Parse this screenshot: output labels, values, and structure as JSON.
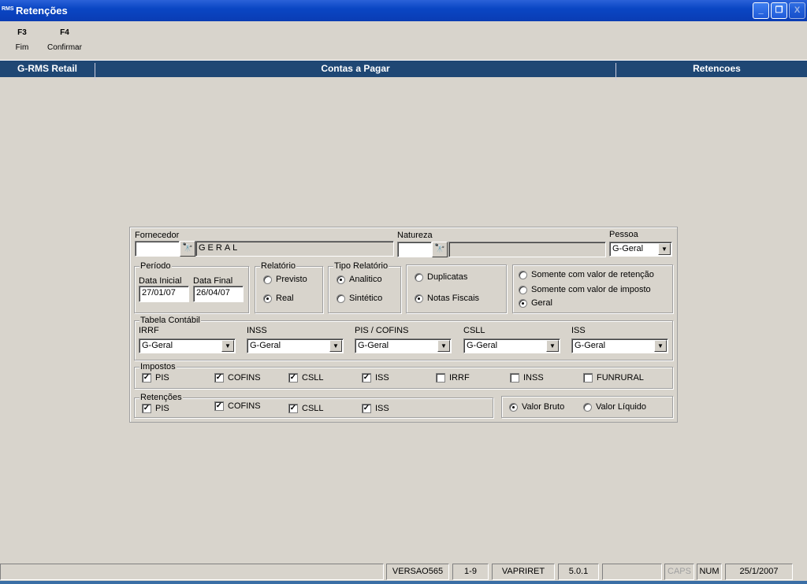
{
  "window": {
    "title": "Retenções",
    "logo": "RMS"
  },
  "toolbar": [
    {
      "key": "F3",
      "label": "Fim"
    },
    {
      "key": "F4",
      "label": "Confirmar"
    }
  ],
  "band": {
    "left": "G-RMS Retail",
    "center": "Contas a Pagar",
    "right": "Retencoes"
  },
  "form": {
    "fornecedor": {
      "label": "Fornecedor",
      "code": "",
      "desc": "GERAL"
    },
    "natureza": {
      "label": "Natureza",
      "code": "",
      "desc": ""
    },
    "pessoa": {
      "label": "Pessoa",
      "value": "G-Geral"
    },
    "periodo": {
      "label": "Período",
      "inicial_label": "Data Inicial",
      "inicial": "27/01/07",
      "final_label": "Data Final",
      "final": "26/04/07"
    },
    "relatorio": {
      "label": "Relatório",
      "options": [
        "Previsto",
        "Real"
      ],
      "selected": "Real"
    },
    "tipo": {
      "label": "Tipo Relatório",
      "options": [
        "Analitico",
        "Sintético"
      ],
      "selected": "Analitico"
    },
    "doc": {
      "options": [
        "Duplicatas",
        "Notas Fiscais"
      ],
      "selected": "Notas Fiscais"
    },
    "filtro": {
      "options": [
        "Somente com valor de retenção",
        "Somente com valor de imposto",
        "Geral"
      ],
      "selected": "Geral"
    },
    "tabela": {
      "label": "Tabela Contábil",
      "fields": [
        {
          "label": "IRRF",
          "value": "G-Geral"
        },
        {
          "label": "INSS",
          "value": "G-Geral"
        },
        {
          "label": "PIS / COFINS",
          "value": "G-Geral"
        },
        {
          "label": "CSLL",
          "value": "G-Geral"
        },
        {
          "label": "ISS",
          "value": "G-Geral"
        }
      ]
    },
    "impostos": {
      "label": "Impostos",
      "items": [
        {
          "label": "PIS",
          "checked": true
        },
        {
          "label": "COFINS",
          "checked": true
        },
        {
          "label": "CSLL",
          "checked": true
        },
        {
          "label": "ISS",
          "checked": true
        },
        {
          "label": "IRRF",
          "checked": false
        },
        {
          "label": "INSS",
          "checked": false
        },
        {
          "label": "FUNRURAL",
          "checked": false
        }
      ]
    },
    "retencoes": {
      "label": "Retenções",
      "items": [
        {
          "label": "PIS",
          "checked": true
        },
        {
          "label": "COFINS",
          "checked": true
        },
        {
          "label": "CSLL",
          "checked": true
        },
        {
          "label": "ISS",
          "checked": true
        }
      ]
    },
    "valor": {
      "options": [
        "Valor Bruto",
        "Valor Líquido"
      ],
      "selected": "Valor Bruto"
    }
  },
  "status": [
    "",
    "VERSAO565",
    "1-9",
    "VAPRIRET",
    "5.0.1",
    "",
    "CAPS",
    "NUM",
    "25/1/2007"
  ]
}
